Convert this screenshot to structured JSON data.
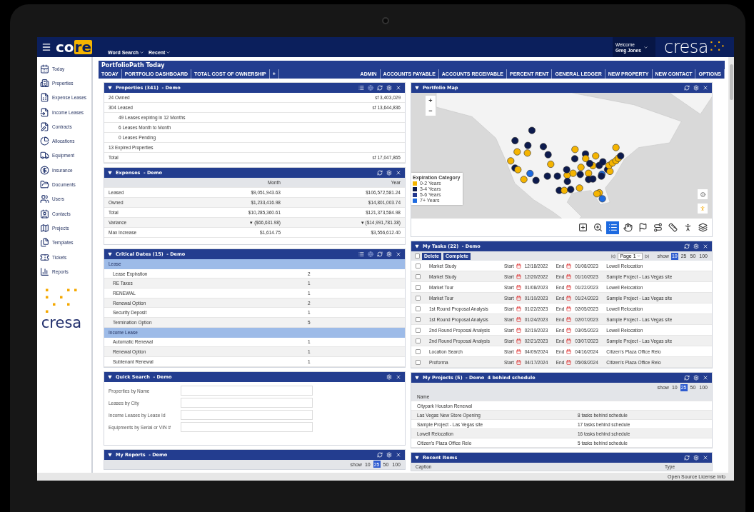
{
  "topbar": {
    "logo_a": "co",
    "logo_b": "re",
    "search_menu": "Word Search",
    "recent_menu": "Recent",
    "welcome": "Welcome",
    "user": "Greg Jones",
    "brand": "cresa"
  },
  "sidebar": {
    "items": [
      {
        "label": "Today"
      },
      {
        "label": "Properties"
      },
      {
        "label": "Expense Leases"
      },
      {
        "label": "Income Leases"
      },
      {
        "label": "Contracts"
      },
      {
        "label": "Allocations"
      },
      {
        "label": "Equipment"
      },
      {
        "label": "Insurance"
      },
      {
        "label": "Documents"
      },
      {
        "label": "Users"
      },
      {
        "label": "Contacts"
      },
      {
        "label": "Projects"
      },
      {
        "label": "Templates"
      },
      {
        "label": "Tickets"
      },
      {
        "label": "Reports"
      }
    ],
    "brand": "cresa"
  },
  "page": {
    "title": "PortfolioPath Today",
    "tabs_left": [
      "TODAY",
      "PORTFOLIO DASHBOARD",
      "TOTAL COST OF OWNERSHIP",
      "+"
    ],
    "tabs_right": [
      "ADMIN",
      "ACCOUNTS PAYABLE",
      "ACCOUNTS RECEIVABLE",
      "PERCENT RENT",
      "GENERAL LEDGER",
      "NEW PROPERTY",
      "NEW CONTACT",
      "OPTIONS"
    ]
  },
  "left_panels": [
    {
      "kind": "summary",
      "title": "Properties (341)  - Demo",
      "view_switch": true,
      "refresh": true,
      "rows": [
        {
          "label": "24 Owned",
          "value": "sf 3,403,029"
        },
        {
          "label": "304 Leased",
          "value": "sf 13,644,836",
          "children": [
            {
              "label": "49 Leases expiring in 12 Months"
            },
            {
              "label": "6 Leases Month to Month"
            },
            {
              "label": "0 Leases Pending"
            }
          ]
        },
        {
          "label": "13 Expired Properties"
        },
        {
          "label": "Total",
          "value": "sf 17,047,865"
        }
      ]
    },
    {
      "kind": "expenses",
      "title": "Expenses  - Demo",
      "view_switch": false,
      "refresh": true,
      "columns": [
        "Month",
        "Year"
      ],
      "rows": [
        {
          "label": "Leased",
          "month": "$9,051,943.63",
          "year": "$106,572,581.24"
        },
        {
          "label": "Owned",
          "month": "$1,233,416.98",
          "year": "$14,801,003.74"
        },
        {
          "label": "Total",
          "month": "$10,285,360.61",
          "year": "$121,373,584.98"
        },
        {
          "label": "Variance",
          "month": "▾ ($66,631.98)",
          "year": "▾ ($14,991,781.38)"
        },
        {
          "label": "Max Increase",
          "month": "$1,614.75",
          "year": "$3,556,612.40"
        }
      ]
    },
    {
      "kind": "dates",
      "title": "Critical Dates (15)  - Demo",
      "view_switch": true,
      "refresh": true,
      "groups": [
        {
          "name": "Lease",
          "items": [
            {
              "label": "Lease Expiration",
              "count": "2"
            },
            {
              "label": "RE Taxes",
              "count": "1"
            },
            {
              "label": "RENEWAL",
              "count": "1"
            },
            {
              "label": "Renewal Option",
              "count": "2"
            },
            {
              "label": "Security Deposit",
              "count": "1"
            },
            {
              "label": "Termination Option",
              "count": "5"
            }
          ]
        },
        {
          "name": "Income Lease",
          "items": [
            {
              "label": "Automatic Renewal",
              "count": "1"
            },
            {
              "label": "Renewal Option",
              "count": "1"
            },
            {
              "label": "Subtenant Renewal",
              "count": "1"
            }
          ]
        }
      ]
    },
    {
      "kind": "search",
      "title": "Quick Search  - Demo",
      "view_switch": false,
      "refresh": false,
      "fields": [
        {
          "label": "Properties by Name"
        },
        {
          "label": "Leases by City"
        },
        {
          "label": "Income Leases by Lease Id"
        },
        {
          "label": "Equipments by Serial or VIN #"
        }
      ]
    },
    {
      "kind": "reports",
      "title": "My Reports  - Demo",
      "view_switch": false,
      "refresh": true,
      "show_label": "show",
      "sizes": [
        {
          "label": "10",
          "selected": false
        },
        {
          "label": "25",
          "selected": true
        },
        {
          "label": "50",
          "selected": false
        },
        {
          "label": "100",
          "selected": false
        }
      ]
    }
  ],
  "right_panels": [
    {
      "kind": "map",
      "title": "Portfolio Map",
      "view_switch": false,
      "refresh": true,
      "zoom_in": "+",
      "zoom_out": "−",
      "legend": {
        "title": "Expiration Category",
        "items": [
          {
            "label": "0-2 Years",
            "color": "#f5b400"
          },
          {
            "label": "3-4 Years",
            "color": "#0c1a4d"
          },
          {
            "label": "5-6 Years",
            "color": "#23388f"
          },
          {
            "label": "7+ Years",
            "color": "#1d6ae0"
          }
        ]
      },
      "tools": [
        {
          "selected": false
        },
        {
          "selected": false
        },
        {
          "selected": true
        },
        {
          "selected": false
        },
        {
          "selected": false
        },
        {
          "selected": false
        },
        {
          "selected": false
        },
        {
          "selected": false
        },
        {
          "selected": false
        }
      ]
    },
    {
      "kind": "tasks",
      "title": "My Tasks (22)  - Demo",
      "view_switch": false,
      "refresh": true,
      "select_all": {
        "checked": false
      },
      "actions": [
        "Delete",
        "Complete"
      ],
      "page": "Page 1",
      "show_label": "show",
      "sizes": [
        {
          "label": "10",
          "selected": true
        },
        {
          "label": "25",
          "selected": false
        },
        {
          "label": "50",
          "selected": false
        },
        {
          "label": "100",
          "selected": false
        }
      ],
      "rows": [
        {
          "checked": false,
          "name": "Market Study",
          "start_label": "Start",
          "start": "12/18/2022",
          "end_label": "End",
          "end": "01/08/2023",
          "project": "Lowell Relocation"
        },
        {
          "checked": false,
          "name": "Market Study",
          "start_label": "Start",
          "start": "12/20/2022",
          "end_label": "End",
          "end": "01/10/2023",
          "project": "Sample Project - Las Vegas site"
        },
        {
          "checked": false,
          "name": "Market Tour",
          "start_label": "Start",
          "start": "01/08/2023",
          "end_label": "End",
          "end": "01/22/2023",
          "project": "Lowell Relocation"
        },
        {
          "checked": false,
          "name": "Market Tour",
          "start_label": "Start",
          "start": "01/10/2023",
          "end_label": "End",
          "end": "01/24/2023",
          "project": "Sample Project - Las Vegas site"
        },
        {
          "checked": false,
          "name": "1st Round Proposal Analysis",
          "start_label": "Start",
          "start": "01/22/2023",
          "end_label": "End",
          "end": "02/05/2023",
          "project": "Lowell Relocation"
        },
        {
          "checked": false,
          "name": "1st Round Proposal Analysis",
          "start_label": "Start",
          "start": "01/24/2023",
          "end_label": "End",
          "end": "02/07/2023",
          "project": "Sample Project - Las Vegas site"
        },
        {
          "checked": false,
          "name": "2nd Round Proposal Analysis",
          "start_label": "Start",
          "start": "02/19/2023",
          "end_label": "End",
          "end": "03/05/2023",
          "project": "Lowell Relocation"
        },
        {
          "checked": false,
          "name": "2nd Round Proposal Analysis",
          "start_label": "Start",
          "start": "02/21/2023",
          "end_label": "End",
          "end": "03/07/2023",
          "project": "Sample Project - Las Vegas site"
        },
        {
          "checked": false,
          "name": "Location Search",
          "start_label": "Start",
          "start": "04/09/2024",
          "end_label": "End",
          "end": "04/16/2024",
          "project": "Citizen's Plaza Office Relo"
        },
        {
          "checked": false,
          "name": "Proforma",
          "start_label": "Start",
          "start": "04/17/2024",
          "end_label": "End",
          "end": "05/08/2024",
          "project": "Citizen's Plaza Office Relo"
        }
      ]
    },
    {
      "kind": "projects",
      "title": "My Projects (5)  - Demo  4 behind schedule",
      "view_switch": false,
      "refresh": true,
      "show_label": "show",
      "sizes": [
        {
          "label": "10",
          "selected": false
        },
        {
          "label": "25",
          "selected": true
        },
        {
          "label": "50",
          "selected": false
        },
        {
          "label": "100",
          "selected": false
        }
      ],
      "columns": [
        "Name"
      ],
      "rows": [
        {
          "name": "Citypark Houston Renewal"
        },
        {
          "name": "Las Vegas New Store Opening",
          "status": "8 tasks behind schedule"
        },
        {
          "name": "Sample Project - Las Vegas site",
          "status": "17 tasks behind schedule"
        },
        {
          "name": "Lowell Relocation",
          "status": "16 tasks behind schedule"
        },
        {
          "name": "Citizen's Plaza Office Relo",
          "status": "5 tasks behind schedule"
        }
      ]
    },
    {
      "kind": "recent",
      "title": "Recent Items",
      "view_switch": false,
      "refresh": true,
      "columns": [
        "Caption",
        "Type"
      ]
    }
  ],
  "footer": {
    "license": "Open Source License Info"
  }
}
